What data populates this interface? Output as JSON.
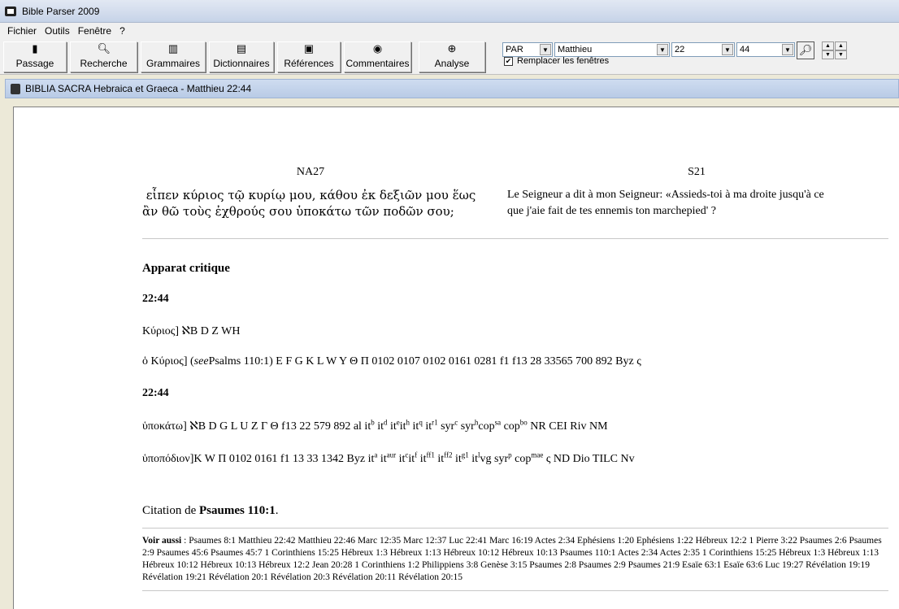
{
  "window": {
    "title": "Bible Parser 2009"
  },
  "menu": [
    "Fichier",
    "Outils",
    "Fenêtre",
    "?"
  ],
  "toolbar": {
    "buttons": [
      {
        "label": "Passage",
        "icon": "book-icon"
      },
      {
        "label": "Recherche",
        "icon": "magnifier-icon"
      },
      {
        "label": "Grammaires",
        "icon": "books-icon"
      },
      {
        "label": "Dictionnaires",
        "icon": "dictionary-icon"
      },
      {
        "label": "Références",
        "icon": "references-icon"
      },
      {
        "label": "Commentaires",
        "icon": "comments-icon"
      },
      {
        "label": "Analyse",
        "icon": "analysis-icon"
      }
    ],
    "version_select": "PAR",
    "book_select": "Matthieu",
    "chapter_select": "22",
    "verse_select": "44",
    "replace_windows_label": "Remplacer les fenêtres",
    "replace_windows_checked": true
  },
  "document": {
    "title": "BIBLIA SACRA Hebraica et Graeca - Matthieu 22:44",
    "left_version": "NA27",
    "right_version": "S21",
    "greek_line1": " εἶπεν κύριος τῷ κυρίῳ μου, κάθου ἐκ δεξιῶν μου ἕως",
    "greek_line2": "ἂν θῶ τοὺς ἐχθρούς σου ὑποκάτω τῶν ποδῶν σου;",
    "french_line1": "Le Seigneur a dit à mon Seigneur: «Assieds-toi à ma droite jusqu'à ce",
    "french_line2": "que j'aie fait de tes ennemis ton marchepied' ?",
    "apparatus_heading": "Apparat critique",
    "ref1": "22:44",
    "var1": "Κύριος] ℵB D Z WH",
    "var2_a": "ὁ Κύριος] (",
    "var2_see": "see",
    "var2_b": "Psalms 110:1) E F G K L W Y Θ Π 0102 0107 0102 0161 0281 f1 f13 28 33565 700 892 Byz ς",
    "ref2": "22:44",
    "var3": {
      "lead": "ὑποκάτω] ℵB D G L U Z Γ Θ f13 22 579 892 al it",
      "s1": "b",
      "t1": " it",
      "s2": "d",
      "t2": " it",
      "s3": "e",
      "t3": "it",
      "s4": "h",
      "t4": " it",
      "s5": "q",
      "t5": " it",
      "s6": "r1",
      "t6": " syr",
      "s7": "c",
      "t7": " syr",
      "s8": "h",
      "t8": "cop",
      "s9": "sa",
      "t9": " cop",
      "s10": "bo",
      "tail": " NR CEI Riv NM"
    },
    "var4": {
      "lead": "ὑποπόδιον]K W Π 0102 0161 f1 13 33 1342 Byz it",
      "s1": "a",
      "t1": " it",
      "s2": "aur",
      "t2": " it",
      "s3": "c",
      "t3": "it",
      "s4": "f",
      "t4": " it",
      "s5": "ff1",
      "t5": " it",
      "s6": "ff2",
      "t6": " it",
      "s7": "g1",
      "t7": " it",
      "s8": "l",
      "t8": "vg syr",
      "s9": "p",
      "t9": " cop",
      "s10": "mae",
      "tail": " ς ND Dio TILC Nv"
    },
    "citation_prefix": "Citation de ",
    "citation_ref": "Psaumes 110:1",
    "citation_suffix": ".",
    "see_also_label": "Voir aussi",
    "see_also_text": " : Psaumes 8:1 Matthieu 22:42 Matthieu 22:46 Marc 12:35 Marc 12:37 Luc 22:41 Marc 16:19 Actes 2:34 Ephésiens 1:20 Ephésiens 1:22 Hébreux 12:2 1 Pierre 3:22 Psaumes 2:6 Psaumes 2:9 Psaumes 45:6 Psaumes 45:7 1 Corinthiens 15:25 Hébreux 1:3 Hébreux 1:13 Hébreux 10:12 Hébreux 10:13 Psaumes 110:1 Actes 2:34 Actes 2:35 1 Corinthiens 15:25 Hébreux 1:3 Hébreux 1:13 Hébreux 10:12 Hébreux 10:13 Hébreux 12:2 Jean 20:28 1 Corinthiens 1:2 Philippiens 3:8 Genèse 3:15 Psaumes 2:8 Psaumes 2:9 Psaumes 21:9 Esaïe 63:1 Esaïe 63:6 Luc 19:27 Révélation 19:19 Révélation 19:21 Révélation 20:1 Révélation 20:3 Révélation 20:11 Révélation 20:15"
  }
}
